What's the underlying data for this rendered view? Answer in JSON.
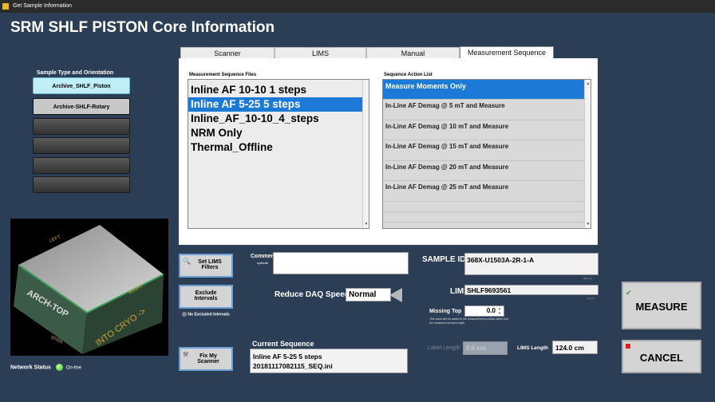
{
  "window": {
    "title": "Get Sample Information",
    "app_title": "SRM SHLF PISTON Core Information"
  },
  "sidebar": {
    "heading": "Sample Type and Orientation",
    "buttons": [
      "Archive_SHLF_Piston",
      "Archive-SHLF-Rotary",
      "",
      "",
      "",
      ""
    ]
  },
  "image": {
    "labels": [
      "LEFT",
      "RIGHT",
      "ARCH-TOP",
      "INTO CRYO ->",
      "STRA"
    ]
  },
  "network": {
    "label": "Network Status",
    "status": "On-line",
    "color": "#3fbf2a"
  },
  "tabs": [
    "Scanner",
    "LIMS",
    "Manual",
    "Measurement Sequence"
  ],
  "files": {
    "label": "Measurement Sequence Files",
    "items": [
      "Inline AF 10-10 1 steps",
      "Inline AF 5-25 5 steps",
      "Inline_AF_10-10_4_steps",
      "NRM Only",
      "Thermal_Offline"
    ],
    "selected_index": 1
  },
  "actions": {
    "label": "Sequence Action List",
    "items": [
      "Measure Moments Only",
      "In-Line AF Demag @ 5 mT and Measure",
      "In-Line AF Demag @ 10 mT and Measure",
      "In-Line AF Demag @ 15 mT and Measure",
      "In-Line AF Demag @ 20 mT and Measure",
      "In-Line AF Demag @ 25 mT and Measure"
    ]
  },
  "controls": {
    "set_lims": "Set LIMS Filters",
    "exclude": "Exclude Intervals",
    "no_excluded": "No Excluded Intervals",
    "fix_scanner": "Fix My Scanner",
    "comment_label": "Comment",
    "comment_sub": "optional",
    "comment_value": "",
    "daq_label": "Reduce DAQ Speed",
    "daq_value": "Normal",
    "current_sequence_label": "Current Sequence",
    "current_sequence_line1": "Inline AF 5-25 5 steps",
    "current_sequence_line2": "20181117082115_SEQ.ini"
  },
  "sample": {
    "sample_id_label": "SAMPLE ID",
    "sample_id": "368X-U1503A-2R-1-A",
    "sample_id_sub": "label_id",
    "lims_id_label": "LIMS ID",
    "lims_id": "SHLF9693561",
    "lims_id_sub": "text_id",
    "missing_top_label": "Missing Top",
    "missing_top": "0.0",
    "missing_top_note": "This value will be added to the measurement position offset and the measured section length.",
    "label_length_label": "Label Length",
    "label_length": "0.0 cm",
    "lims_length_label": "LIMS Length",
    "lims_length": "124.0 cm"
  },
  "actions_buttons": {
    "measure": "MEASURE",
    "cancel": "CANCEL"
  }
}
